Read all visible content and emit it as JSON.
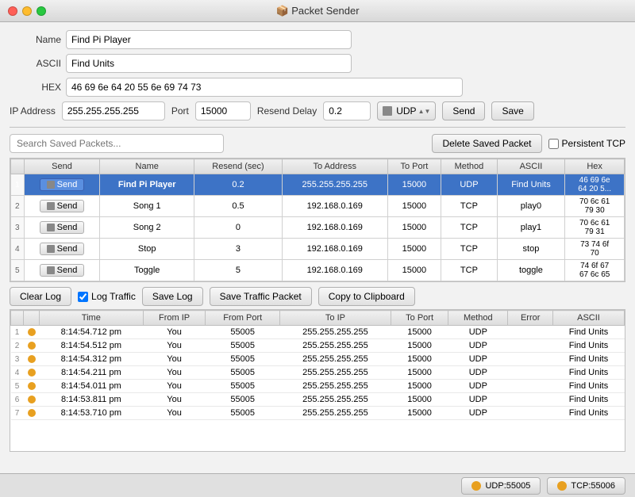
{
  "titlebar": {
    "title": "📦 Packet Sender"
  },
  "form": {
    "name_label": "Name",
    "name_value": "Find Pi Player",
    "ascii_label": "ASCII",
    "ascii_value": "Find Units",
    "hex_label": "HEX",
    "hex_value": "46 69 6e 64 20 55 6e 69 74 73",
    "ip_label": "IP Address",
    "ip_value": "255.255.255.255",
    "port_label": "Port",
    "port_value": "15000",
    "delay_label": "Resend Delay",
    "delay_value": "0.2",
    "protocol": "UDP",
    "send_label": "Send",
    "save_label": "Save"
  },
  "search": {
    "placeholder": "Search Saved Packets...",
    "delete_btn": "Delete Saved Packet",
    "persistent_label": "Persistent TCP"
  },
  "table": {
    "headers": [
      "Send",
      "Name",
      "Resend (sec)",
      "To Address",
      "To Port",
      "Method",
      "ASCII",
      "Hex"
    ],
    "rows": [
      {
        "num": "1",
        "name": "Find Pi Player",
        "resend": "0.2",
        "address": "255.255.255.255",
        "port": "15000",
        "method": "UDP",
        "ascii": "Find Units",
        "hex": "46 69 6e\n64 20 5...",
        "selected": true
      },
      {
        "num": "2",
        "name": "Song 1",
        "resend": "0.5",
        "address": "192.168.0.169",
        "port": "15000",
        "method": "TCP",
        "ascii": "play0",
        "hex": "70 6c 61\n79 30",
        "selected": false
      },
      {
        "num": "3",
        "name": "Song 2",
        "resend": "0",
        "address": "192.168.0.169",
        "port": "15000",
        "method": "TCP",
        "ascii": "play1",
        "hex": "70 6c 61\n79 31",
        "selected": false
      },
      {
        "num": "4",
        "name": "Stop",
        "resend": "3",
        "address": "192.168.0.169",
        "port": "15000",
        "method": "TCP",
        "ascii": "stop",
        "hex": "73 74 6f\n70",
        "selected": false
      },
      {
        "num": "5",
        "name": "Toggle",
        "resend": "5",
        "address": "192.168.0.169",
        "port": "15000",
        "method": "TCP",
        "ascii": "toggle",
        "hex": "74 6f 67\n67 6c 65",
        "selected": false
      }
    ]
  },
  "log": {
    "clear_btn": "Clear Log",
    "log_traffic_label": "Log Traffic",
    "save_log_btn": "Save Log",
    "save_traffic_btn": "Save Traffic Packet",
    "copy_btn": "Copy to Clipboard",
    "headers": [
      "Time",
      "From IP",
      "From Port",
      "To IP",
      "To Port",
      "Method",
      "Error",
      "ASCII"
    ],
    "rows": [
      {
        "num": "1",
        "time": "8:14:54.712 pm",
        "from_ip": "You",
        "from_port": "55005",
        "to_ip": "255.255.255.255",
        "to_port": "15000",
        "method": "UDP",
        "error": "",
        "ascii": "Find Units"
      },
      {
        "num": "2",
        "time": "8:14:54.512 pm",
        "from_ip": "You",
        "from_port": "55005",
        "to_ip": "255.255.255.255",
        "to_port": "15000",
        "method": "UDP",
        "error": "",
        "ascii": "Find Units"
      },
      {
        "num": "3",
        "time": "8:14:54.312 pm",
        "from_ip": "You",
        "from_port": "55005",
        "to_ip": "255.255.255.255",
        "to_port": "15000",
        "method": "UDP",
        "error": "",
        "ascii": "Find Units"
      },
      {
        "num": "4",
        "time": "8:14:54.211 pm",
        "from_ip": "You",
        "from_port": "55005",
        "to_ip": "255.255.255.255",
        "to_port": "15000",
        "method": "UDP",
        "error": "",
        "ascii": "Find Units"
      },
      {
        "num": "5",
        "time": "8:14:54.011 pm",
        "from_ip": "You",
        "from_port": "55005",
        "to_ip": "255.255.255.255",
        "to_port": "15000",
        "method": "UDP",
        "error": "",
        "ascii": "Find Units"
      },
      {
        "num": "6",
        "time": "8:14:53.811 pm",
        "from_ip": "You",
        "from_port": "55005",
        "to_ip": "255.255.255.255",
        "to_port": "15000",
        "method": "UDP",
        "error": "",
        "ascii": "Find Units"
      },
      {
        "num": "7",
        "time": "8:14:53.710 pm",
        "from_ip": "You",
        "from_port": "55005",
        "to_ip": "255.255.255.255",
        "to_port": "15000",
        "method": "UDP",
        "error": "",
        "ascii": "Find Units"
      }
    ]
  },
  "footer": {
    "udp_btn": "UDP:55005",
    "tcp_btn": "TCP:55006"
  }
}
